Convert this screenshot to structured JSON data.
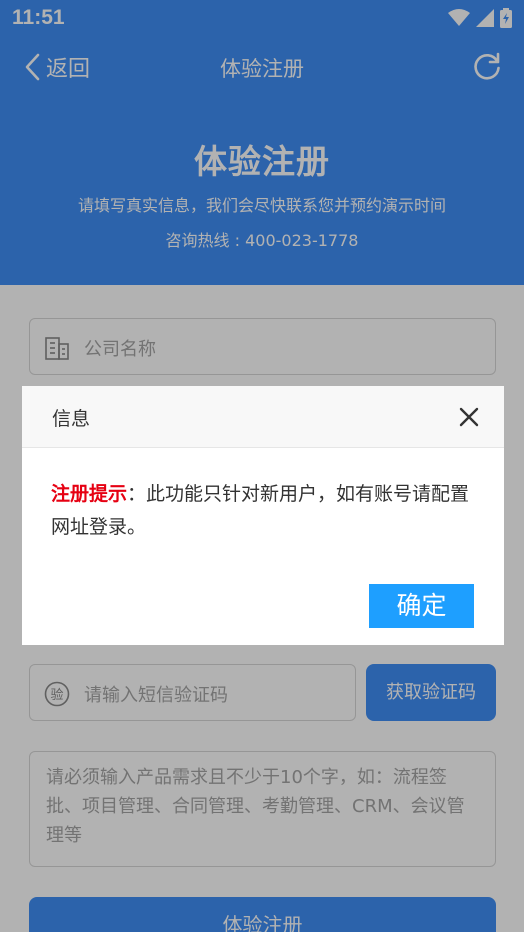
{
  "status_bar": {
    "time": "11:51"
  },
  "navbar": {
    "back_label": "返回",
    "title": "体验注册"
  },
  "hero": {
    "title": "体验注册",
    "subtitle": "请填写真实信息，我们会尽快联系您并预约演示时间",
    "hotline": "咨询热线 : 400-023-1778"
  },
  "form": {
    "company_placeholder": "公司名称",
    "sms_placeholder": "请输入短信验证码",
    "get_code_label": "获取验证码",
    "requirement_placeholder": "请必须输入产品需求且不少于10个字，如：流程签批、项目管理、合同管理、考勤管理、CRM、会议管理等",
    "submit_label": "体验注册",
    "sms_icon_glyph": "验"
  },
  "dialog": {
    "title": "信息",
    "notice_label": "注册提示",
    "message": "：此功能只针对新用户，如有账号请配置网址登录。",
    "ok_label": "确定"
  },
  "colors": {
    "brand_blue": "#3f8ef5",
    "ok_button": "#1e9fff",
    "notice_red": "#e60012"
  }
}
